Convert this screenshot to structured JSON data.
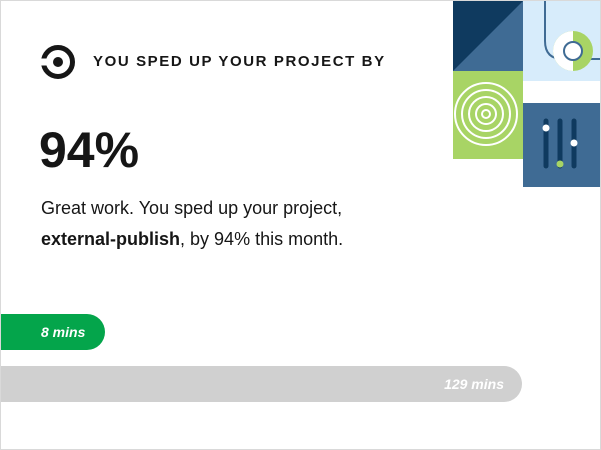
{
  "headline": "YOU SPED UP YOUR PROJECT BY",
  "percent": "94%",
  "description": {
    "line1": "Great work. You sped up your project,",
    "project": "external-publish",
    "rest": ", by 94% this month."
  },
  "bars": {
    "new": {
      "label": "8 mins",
      "minutes": 8
    },
    "old": {
      "label": "129 mins",
      "minutes": 129
    }
  },
  "colors": {
    "accent_green": "#04a54b",
    "bar_gray": "#d0d0d0",
    "text": "#161616",
    "navy": "#0f3a5f",
    "slate_blue": "#3f6b94",
    "light_green": "#a8d465",
    "pale_blue": "#d7ecfb"
  },
  "icons": {
    "logo": "circleci-logo",
    "art": "decorative-geometric-tiles"
  }
}
